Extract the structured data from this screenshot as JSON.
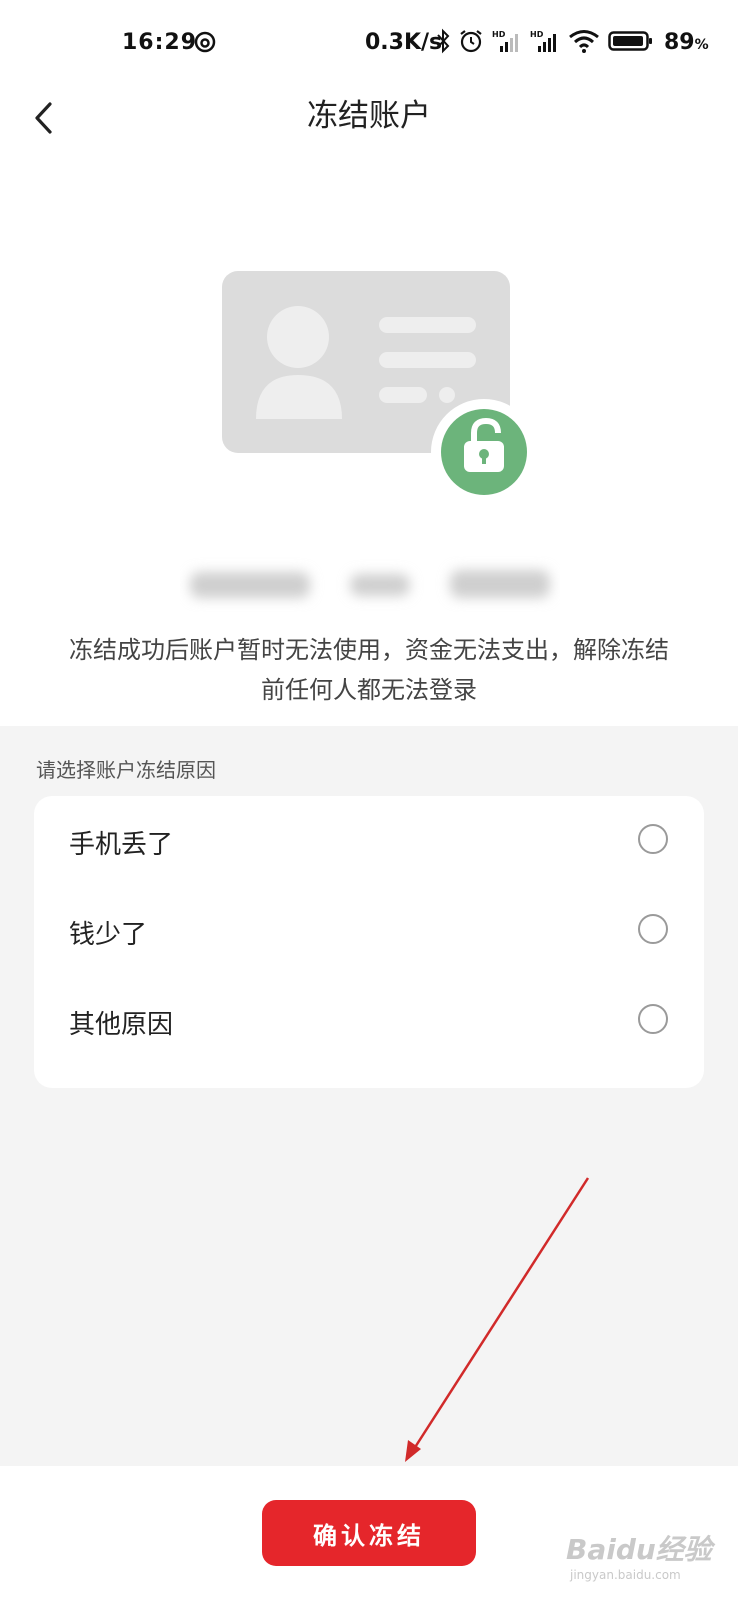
{
  "status_bar": {
    "time": "16:29",
    "network_speed": "0.3K/s",
    "battery_value": "89",
    "battery_unit": "%",
    "icons": [
      "bluetooth-icon",
      "alarm-icon",
      "hd-signal-icon",
      "hd-signal-icon",
      "wifi-icon",
      "battery-icon"
    ]
  },
  "nav": {
    "title": "冻结账户",
    "back_icon": "chevron-left-icon"
  },
  "illustration": {
    "card_icon": "id-card-icon",
    "lock_icon": "unlocked-padlock-icon",
    "lock_color": "#6cb47b"
  },
  "notice": {
    "line1": "冻结成功后账户暂时无法使用，资金无法支出，解除冻结",
    "line2": "前任何人都无法登录"
  },
  "reasons": {
    "label": "请选择账户冻结原因",
    "options": [
      {
        "label": "手机丢了",
        "selected": false
      },
      {
        "label": "钱少了",
        "selected": false
      },
      {
        "label": "其他原因",
        "selected": false
      }
    ]
  },
  "actions": {
    "confirm_label": "确认冻结",
    "accent_color": "#e5262b"
  },
  "watermark": {
    "brand": "Baidu经验",
    "site": "jingyan.baidu.com"
  }
}
